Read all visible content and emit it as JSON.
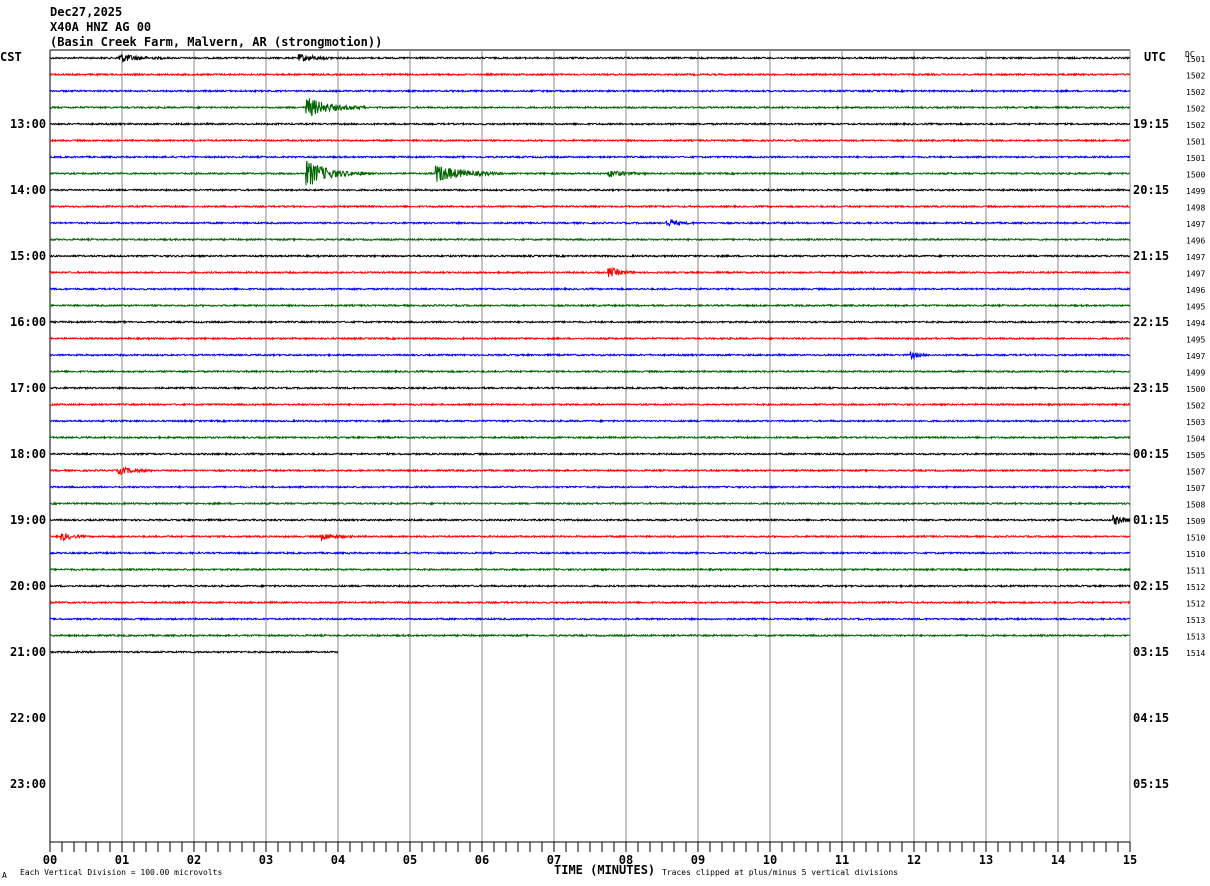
{
  "header": {
    "date": "Dec27,2025",
    "station": "X40A HNZ AG 00",
    "location": "(Basin Creek Farm, Malvern, AR (strongmotion))"
  },
  "left_tz": "CST",
  "right_tz": "UTC",
  "dc_label": "DC",
  "footer": {
    "corner_mark": "A",
    "scale_note": "Each Vertical Division =  100.00 microvolts",
    "clip_note": "Traces clipped at plus/minus 5 vertical divisions"
  },
  "chart_data": {
    "type": "line",
    "subtype": "helicorder",
    "xlabel": "TIME (MINUTES)",
    "xlim": [
      0,
      15
    ],
    "x_ticks": [
      "00",
      "01",
      "02",
      "03",
      "04",
      "05",
      "06",
      "07",
      "08",
      "09",
      "10",
      "11",
      "12",
      "13",
      "14",
      "15"
    ],
    "left_hour_labels": [
      "13:00",
      "14:00",
      "15:00",
      "16:00",
      "17:00",
      "18:00",
      "19:00",
      "20:00",
      "21:00",
      "22:00",
      "23:00"
    ],
    "right_hour_labels": [
      "19:15",
      "20:15",
      "21:15",
      "22:15",
      "23:15",
      "00:15",
      "01:15",
      "02:15",
      "03:15",
      "04:15",
      "05:15"
    ],
    "trace_colors": [
      "#000000",
      "#ff0000",
      "#0000ff",
      "#006400"
    ],
    "trace_count": 37,
    "last_trace_end_minute": 4,
    "dc_values": [
      "1501",
      "1502",
      "1502",
      "1502",
      "1502",
      "1501",
      "1501",
      "1500",
      "1499",
      "1498",
      "1497",
      "1496",
      "1497",
      "1497",
      "1496",
      "1495",
      "1494",
      "1495",
      "1497",
      "1499",
      "1500",
      "1502",
      "1503",
      "1504",
      "1505",
      "1507",
      "1507",
      "1508",
      "1509",
      "1510",
      "1510",
      "1511",
      "1512",
      "1512",
      "1513",
      "1513",
      "1514"
    ],
    "events": [
      {
        "trace": 0,
        "minute": 1.0,
        "amplitude": 4,
        "duration": 0.6
      },
      {
        "trace": 0,
        "minute": 3.5,
        "amplitude": 3,
        "duration": 0.6
      },
      {
        "trace": 3,
        "minute": 3.6,
        "amplitude": 9,
        "duration": 0.8
      },
      {
        "trace": 7,
        "minute": 3.6,
        "amplitude": 12,
        "duration": 0.8
      },
      {
        "trace": 7,
        "minute": 5.4,
        "amplitude": 8,
        "duration": 0.9
      },
      {
        "trace": 7,
        "minute": 7.8,
        "amplitude": 3,
        "duration": 0.5
      },
      {
        "trace": 10,
        "minute": 8.6,
        "amplitude": 3,
        "duration": 0.4
      },
      {
        "trace": 13,
        "minute": 7.8,
        "amplitude": 4,
        "duration": 0.4
      },
      {
        "trace": 18,
        "minute": 12.0,
        "amplitude": 3,
        "duration": 0.2
      },
      {
        "trace": 25,
        "minute": 1.0,
        "amplitude": 3,
        "duration": 0.5
      },
      {
        "trace": 28,
        "minute": 14.8,
        "amplitude": 4,
        "duration": 0.4
      },
      {
        "trace": 29,
        "minute": 0.2,
        "amplitude": 3,
        "duration": 0.3
      },
      {
        "trace": 29,
        "minute": 3.8,
        "amplitude": 3,
        "duration": 0.5
      }
    ]
  }
}
